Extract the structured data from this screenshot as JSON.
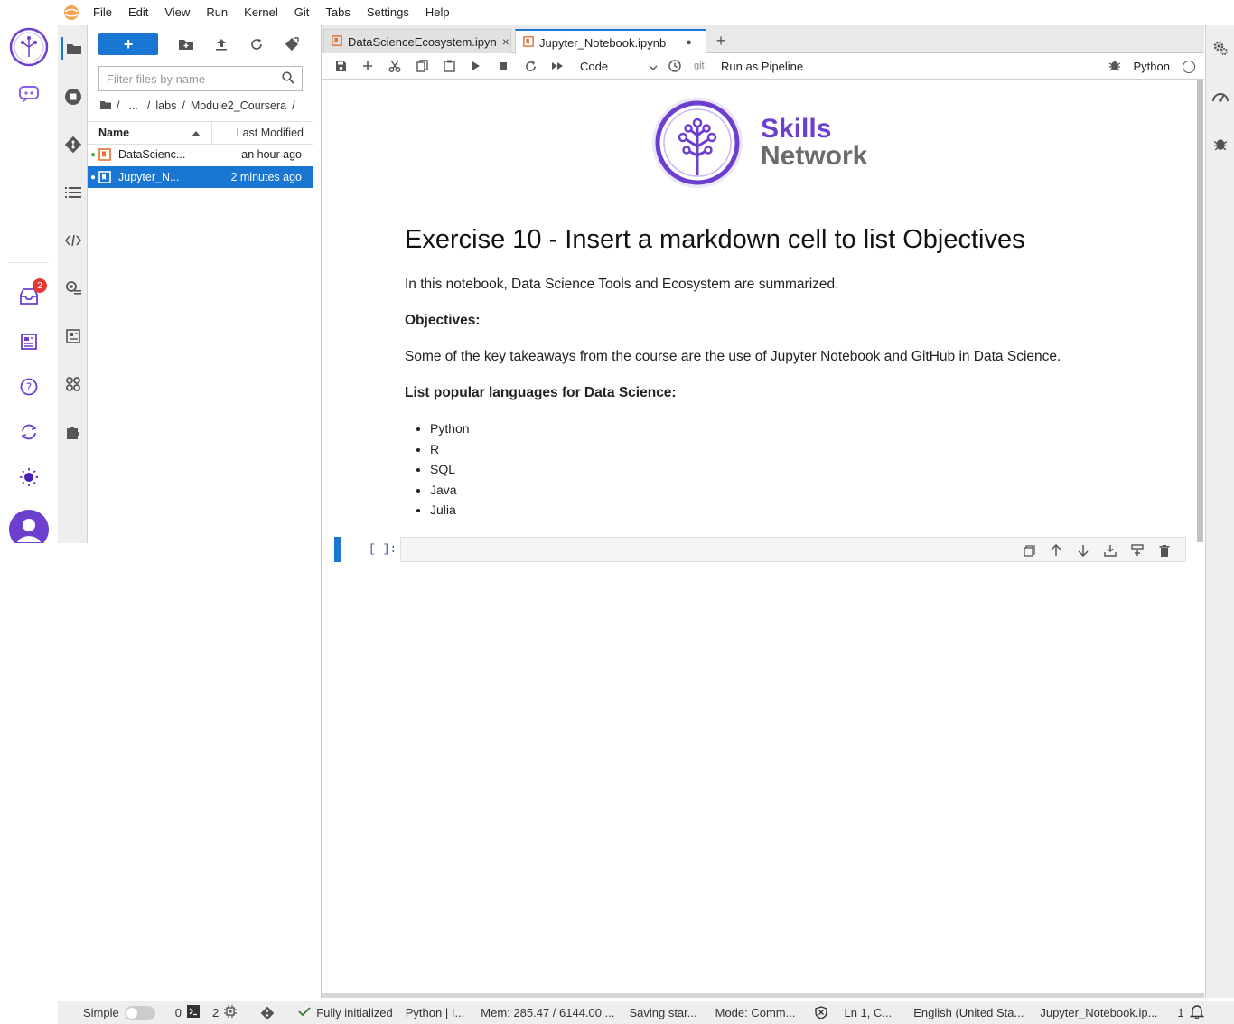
{
  "menubar": {
    "items": [
      "File",
      "Edit",
      "View",
      "Run",
      "Kernel",
      "Git",
      "Tabs",
      "Settings",
      "Help"
    ]
  },
  "sn_rail": {
    "inbox_badge": "2"
  },
  "filebrowser": {
    "new_label": "+",
    "filter_placeholder": "Filter files by name",
    "breadcrumb": [
      "/",
      "...",
      "/",
      "labs",
      "/",
      "Module2_Coursera",
      "/"
    ],
    "columns": {
      "name": "Name",
      "modified": "Last Modified"
    },
    "files": [
      {
        "name": "DataScienc...",
        "modified": "an hour ago",
        "selected": false
      },
      {
        "name": "Jupyter_N...",
        "modified": "2 minutes ago",
        "selected": true
      }
    ]
  },
  "tabs": [
    {
      "label": "DataScienceEcosystem.ipyn",
      "close": "×",
      "active": false
    },
    {
      "label": "Jupyter_Notebook.ipynb",
      "close": "●",
      "active": true
    }
  ],
  "toolbar": {
    "cell_type": "Code",
    "git_label": "git",
    "pipeline_label": "Run as Pipeline",
    "kernel_name": "Python"
  },
  "notebook": {
    "logo_skills": "Skills",
    "logo_network": "Network",
    "heading": "Exercise 10 - Insert a markdown cell to list Objectives",
    "intro": "In this notebook, Data Science Tools and Ecosystem are summarized.",
    "objectives_title": "Objectives:",
    "objectives_text": "Some of the key takeaways from the course are the use of Jupyter Notebook and GitHub in Data Science.",
    "languages_title": "List popular languages for Data Science:",
    "languages": [
      "Python",
      "R",
      "SQL",
      "Java",
      "Julia"
    ],
    "prompt": "[ ]:"
  },
  "statusbar": {
    "mode_label": "Simple",
    "terminals_count": "0",
    "kernels_count": "2",
    "kernel_status": "Fully initialized",
    "kernel_info": "Python | I...",
    "memory": "Mem: 285.47 / 6144.00 ...",
    "saving": "Saving star...",
    "command_mode": "Mode: Comm...",
    "cursor": "Ln 1, C...",
    "language": "English (United Sta...",
    "file": "Jupyter_Notebook.ip...",
    "notifications": "1"
  },
  "colors": {
    "accent": "#1976d2",
    "brand_purple": "#6c3fcf",
    "badge_red": "#e53935"
  }
}
